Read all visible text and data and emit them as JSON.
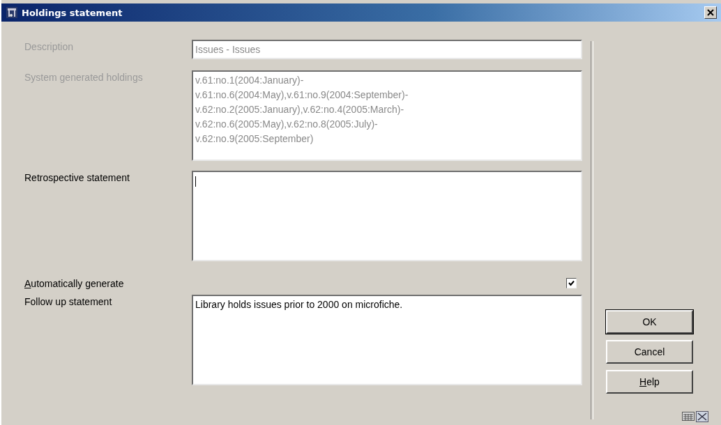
{
  "window": {
    "title": "Holdings statement"
  },
  "fields": [
    {
      "kind": "input",
      "label": "Description",
      "value": "Issues - Issues",
      "disabled": true
    },
    {
      "kind": "textarea",
      "label": "System generated holdings",
      "lines": [
        "v.61:no.1(2004:January)-",
        "v.61:no.6(2004:May),v.61:no.9(2004:September)-",
        "v.62:no.2(2005:January),v.62:no.4(2005:March)-",
        "v.62:no.6(2005:May),v.62:no.8(2005:July)-",
        "v.62:no.9(2005:September)"
      ],
      "disabled": true
    },
    {
      "kind": "textarea",
      "label": "Retrospective statement",
      "disabled": false,
      "focused": true
    },
    {
      "kind": "checkbox",
      "label": "Automatically generate",
      "mnemonic_underlined": true,
      "checked": true
    },
    {
      "kind": "textarea",
      "label": "Follow up statement",
      "lines": [
        "Library holds issues prior to 2000 on microfiche."
      ],
      "disabled": false
    }
  ],
  "buttons": [
    {
      "label": "OK",
      "mnemonic_underlined": false,
      "default": true
    },
    {
      "label": "Cancel",
      "mnemonic_underlined": false,
      "default": false
    },
    {
      "label": "Help",
      "mnemonic_underlined": true,
      "default": false
    }
  ]
}
